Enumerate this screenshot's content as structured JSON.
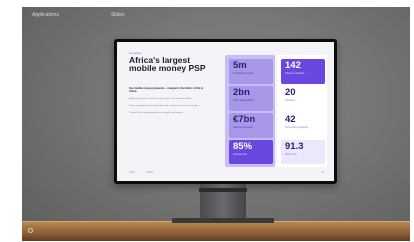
{
  "topbar": {
    "left_label": "Applications",
    "center_label": "Slides"
  },
  "slide": {
    "eyebrow": "Company",
    "title": "Africa's largest\nmobile money PSP",
    "lead": "Our mobile money payments – integral to the fabric of life in Africa.",
    "paragraphs": [
      "Helping businesses of all sizes grow across 34 countries in Africa.",
      "Processing payments for merchants and consumers at scale every day.",
      "Trusted by the leading brands in the region and beyond."
    ],
    "footer_left": [
      "Nala",
      "Slides"
    ],
    "footer_right": "01"
  },
  "stats_left": [
    {
      "value": "5m",
      "label": "Transactions a day",
      "style": "light"
    },
    {
      "value": "2bn",
      "label": "Users across Africa",
      "style": "light"
    },
    {
      "value": "€7bn",
      "label": "Volume processed",
      "style": "light"
    },
    {
      "value": "85%",
      "label": "Success rate",
      "style": "dark"
    }
  ],
  "stats_right": [
    {
      "value": "142",
      "label": "Payment methods",
      "style": "dark"
    },
    {
      "value": "20",
      "label": "Countries",
      "style": "plain"
    },
    {
      "value": "42",
      "label": "Currencies supported",
      "style": "plain"
    },
    {
      "value": "91.3",
      "label": "NPS score",
      "style": "tint"
    }
  ],
  "colors": {
    "accent": "#6a47e0",
    "accent_light": "#a897e8",
    "screen_bg": "#f4f3f7"
  }
}
